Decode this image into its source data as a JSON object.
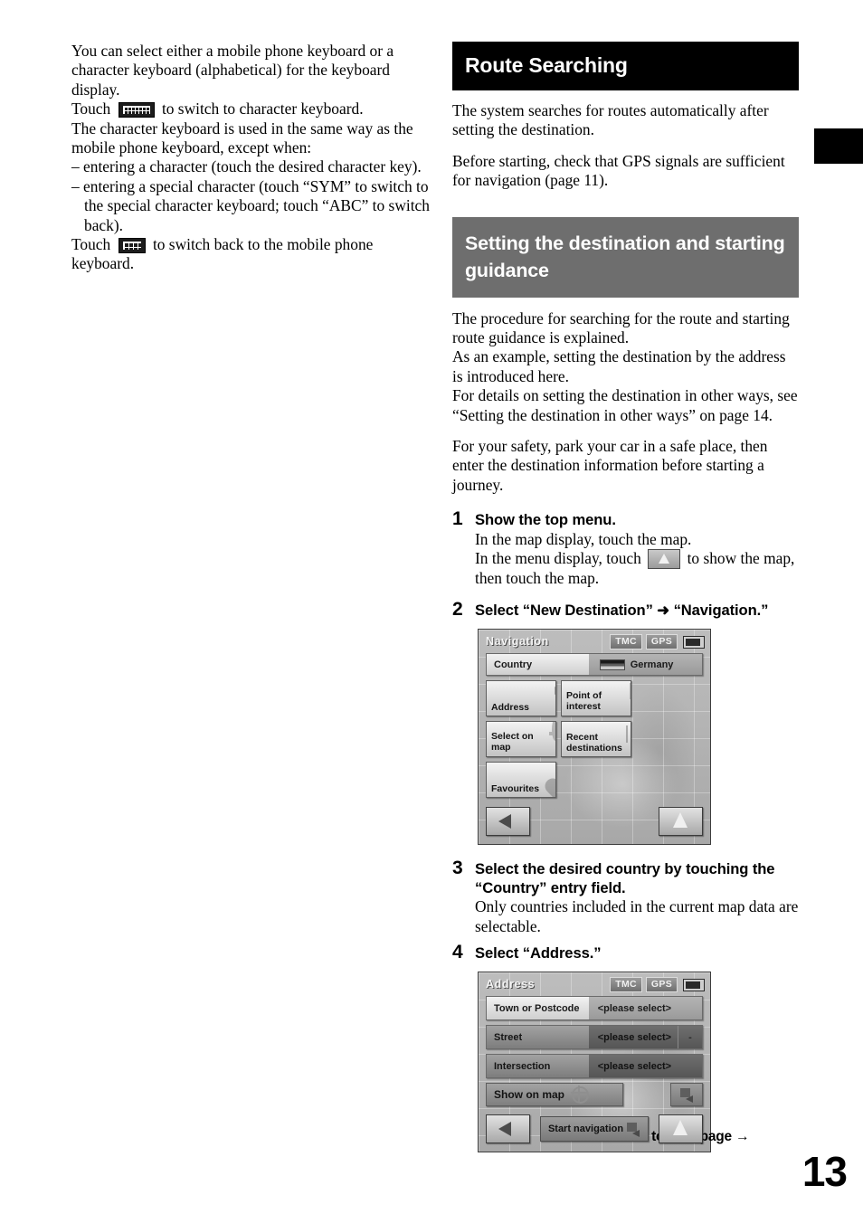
{
  "left_column": {
    "paragraph_1": "You can select either a mobile phone keyboard or a character keyboard (alphabetical) for the keyboard display.",
    "touch_1_before": "Touch",
    "touch_1_after": "to switch to character keyboard.",
    "paragraph_2": "The character keyboard is used in the same way as the mobile phone keyboard, except when:",
    "bullets": [
      "– entering a character (touch the desired character key).",
      "– entering a special character (touch “SYM” to switch to the special character keyboard; touch “ABC” to switch back)."
    ],
    "touch_2_before": "Touch",
    "touch_2_after": "to switch back to the mobile phone keyboard."
  },
  "right_column": {
    "header_route_searching": "Route Searching",
    "route_para_1": "The system searches for routes automatically after setting the destination.",
    "route_para_2": "Before starting, check that GPS signals are sufficient for navigation (page 11).",
    "header_setting_destination": "Setting the destination and starting guidance",
    "intro_para_1": "The procedure for searching for the route and starting route guidance is explained.\nAs an example, setting the destination by the address is introduced here.\nFor details on setting the destination in other ways, see “Setting the destination in other ways” on page 14.",
    "intro_para_2": "For your safety, park your car in a safe place, then enter the destination information before starting a journey."
  },
  "steps": [
    {
      "number": "1",
      "title": "Show the top menu.",
      "desc_line_1": "In the map display, touch the map.",
      "desc_line_2_before": "In the menu display, touch",
      "desc_line_2_after": "to show the map, then touch the map."
    },
    {
      "number": "2",
      "title": "Select “New Destination” ➜ “Navigation.”"
    },
    {
      "number": "3",
      "title": "Select the desired country by touching the “Country” entry field.",
      "desc": "Only countries included in the current map data are selectable."
    },
    {
      "number": "4",
      "title": "Select “Address.”"
    }
  ],
  "navigation_screen": {
    "title": "Navigation",
    "status": {
      "tmc": "TMC",
      "gps": "GPS",
      "battery_icon": "battery-icon"
    },
    "country_row": {
      "label": "Country",
      "value": "Germany",
      "flag_icon": "german-flag-icon"
    },
    "tiles": [
      {
        "label": "Address",
        "icon": "signpost-icon"
      },
      {
        "label": "Point of\ninterest",
        "icon": "parking-fuel-icon"
      },
      {
        "label": "Select on\nmap",
        "icon": "crosshair-icon"
      },
      {
        "label": "Recent\ndestinations",
        "icon": "list-icon"
      },
      {
        "label": "Favourites",
        "icon": "heart-icon"
      }
    ],
    "footer": {
      "back_icon": "back-arrow-icon",
      "map_icon": "navigation-cursor-icon"
    }
  },
  "address_screen": {
    "title": "Address",
    "status": {
      "tmc": "TMC",
      "gps": "GPS",
      "battery_icon": "battery-icon"
    },
    "rows": [
      {
        "label": "Town or Postcode",
        "value": "<please select>",
        "extra": ""
      },
      {
        "label": "Street",
        "value": "<please select>",
        "extra": "-"
      },
      {
        "label": "Intersection",
        "value": "<please select>",
        "extra": ""
      }
    ],
    "show_on_map": "Show on map",
    "start_navigation": "Start navigation",
    "footer": {
      "back_icon": "back-arrow-icon",
      "map_icon": "navigation-cursor-icon",
      "corner_icon": "goto-flag-icon"
    }
  },
  "footer": {
    "continue_note": "continue to next page →",
    "page_number": "13"
  }
}
